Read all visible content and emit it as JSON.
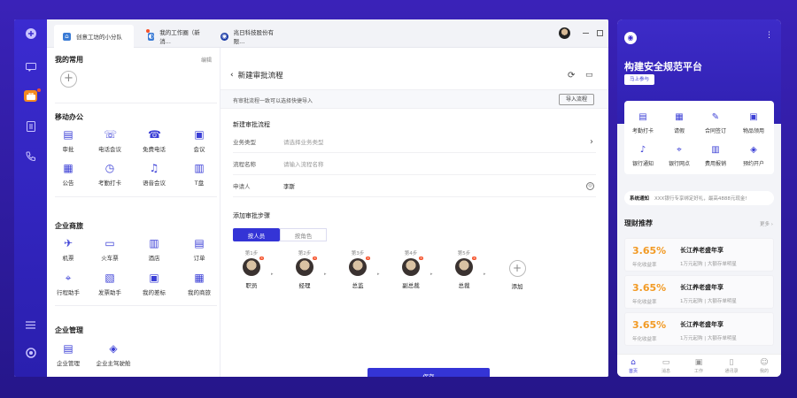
{
  "tabs": [
    {
      "label": "创意工坊的小分队"
    },
    {
      "label": "我的工作圈（新消..."
    },
    {
      "label": "兆日科技股份有限..."
    }
  ],
  "sidebar": {
    "favorites_title": "我的常用",
    "edit_label": "编辑",
    "mobile_office_title": "移动办公",
    "mobile_office": [
      {
        "label": "审批",
        "icon": "approval-icon"
      },
      {
        "label": "电话会议",
        "icon": "phone-conference-icon"
      },
      {
        "label": "免费电话",
        "icon": "free-call-icon"
      },
      {
        "label": "会议",
        "icon": "meeting-icon"
      },
      {
        "label": "公告",
        "icon": "announcement-icon"
      },
      {
        "label": "考勤打卡",
        "icon": "attendance-icon"
      },
      {
        "label": "语音会议",
        "icon": "voice-meeting-icon"
      },
      {
        "label": "T盘",
        "icon": "t-drive-icon"
      }
    ],
    "business_travel_title": "企业商旅",
    "business_travel": [
      {
        "label": "机票",
        "icon": "plane-icon"
      },
      {
        "label": "火车票",
        "icon": "train-icon"
      },
      {
        "label": "酒店",
        "icon": "hotel-icon"
      },
      {
        "label": "订单",
        "icon": "order-icon"
      },
      {
        "label": "行程助手",
        "icon": "trip-icon"
      },
      {
        "label": "发票助手",
        "icon": "invoice-icon"
      },
      {
        "label": "我的差标",
        "icon": "travel-standard-icon"
      },
      {
        "label": "我的商旅",
        "icon": "my-travel-icon"
      }
    ],
    "enterprise_title": "企业管理",
    "enterprise": [
      {
        "label": "企业管理",
        "icon": "enterprise-manage-icon"
      },
      {
        "label": "企业主驾驶舱",
        "icon": "cockpit-icon"
      }
    ]
  },
  "main": {
    "back_title": "新建审批流程",
    "notice": "有审批流程一致可以选择快捷导入",
    "import_button": "导入流程",
    "section_title": "新建审批流程",
    "fields": [
      {
        "label": "业务类型",
        "value": "请选择业务类型"
      },
      {
        "label": "流程名称",
        "value": "请输入流程名称"
      },
      {
        "label": "申请人",
        "value": "李斯"
      }
    ],
    "steps_title": "添加审批步骤",
    "toggle_person": "按人员",
    "toggle_role": "按角色",
    "steps": [
      {
        "step": "第1步",
        "name": "职员"
      },
      {
        "step": "第2步",
        "name": "经理"
      },
      {
        "step": "第3步",
        "name": "总监"
      },
      {
        "step": "第4步",
        "name": "副总裁"
      },
      {
        "step": "第5步",
        "name": "总裁"
      }
    ],
    "add_label": "添加",
    "save_label": "保存"
  },
  "phone": {
    "title": "构建安全规范平台",
    "cta": "马上参与",
    "quick": [
      {
        "label": "考勤打卡"
      },
      {
        "label": "请假"
      },
      {
        "label": "合同签订"
      },
      {
        "label": "物品领用"
      },
      {
        "label": "银行通知"
      },
      {
        "label": "银行网点"
      },
      {
        "label": "费用报销"
      },
      {
        "label": "预约开户"
      }
    ],
    "notice_label": "系统通知",
    "notice_text": "XXX银行专享绑定好礼，最高4888元现金!",
    "finance_title": "理财推荐",
    "more_label": "更多",
    "products": [
      {
        "rate": "3.65%",
        "rate_label": "年化收益率",
        "title": "长江养老盛年享",
        "sub": "1万元起购 | 大额存单明星"
      },
      {
        "rate": "3.65%",
        "rate_label": "年化收益率",
        "title": "长江养老盛年享",
        "sub": "1万元起购 | 大额存单明星"
      },
      {
        "rate": "3.65%",
        "rate_label": "年化收益率",
        "title": "长江养老盛年享",
        "sub": "1万元起购 | 大额存单明星"
      }
    ],
    "nav": [
      {
        "label": "首页"
      },
      {
        "label": "消息"
      },
      {
        "label": "工作"
      },
      {
        "label": "通讯录"
      },
      {
        "label": "我的"
      }
    ]
  },
  "colors": {
    "accent": "#3434d6",
    "orange": "#f29a24",
    "badge": "#f5522b"
  }
}
